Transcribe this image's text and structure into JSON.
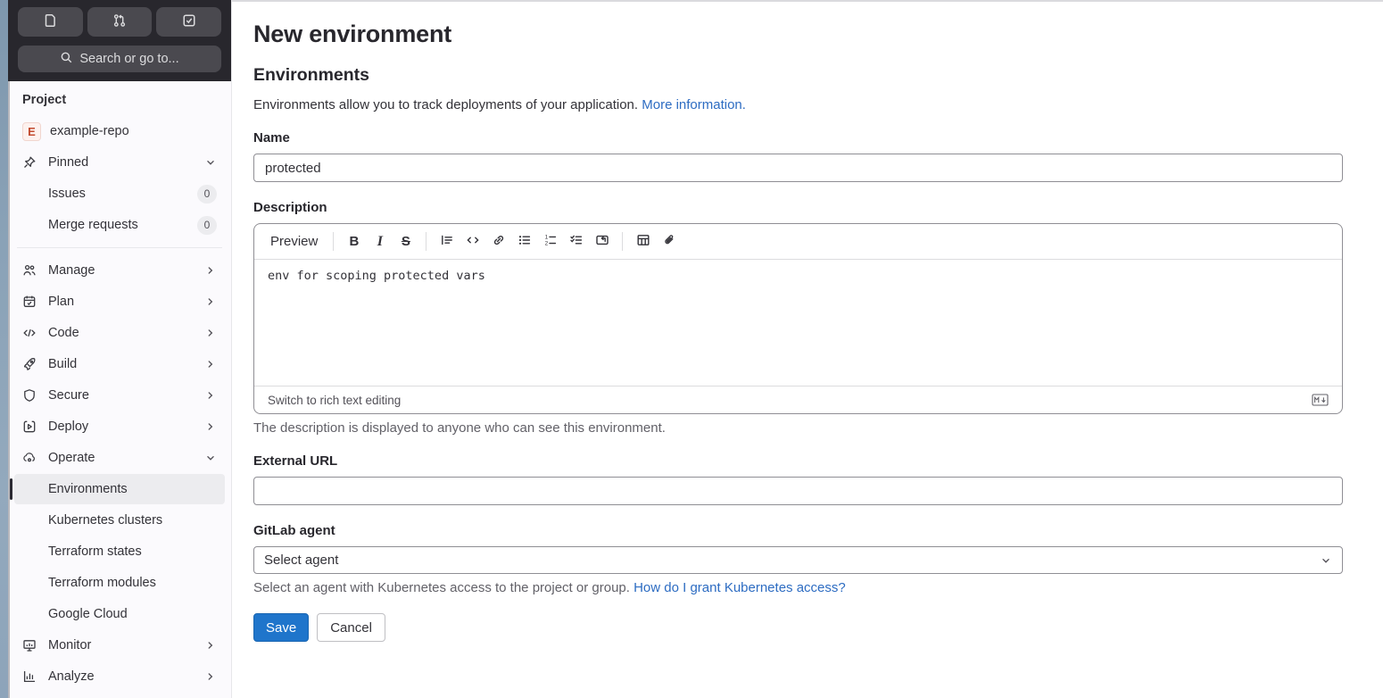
{
  "colors": {
    "sidebar_dark": "#28272d",
    "sidebar_button": "#4a494f",
    "active_item_bg": "#ececef",
    "accent_blue": "#1f75cb",
    "link_blue": "#2d6cc2",
    "avatar_red": "#c24a2e"
  },
  "sidebar": {
    "header_icons": [
      "issues-icon",
      "merge-request-icon",
      "todo-check-icon"
    ],
    "search_label": "Search or go to...",
    "section_label": "Project",
    "project": {
      "initial": "E",
      "name": "example-repo"
    },
    "items": {
      "pinned": "Pinned",
      "issues": "Issues",
      "issues_badge": "0",
      "merge_requests": "Merge requests",
      "merge_requests_badge": "0",
      "manage": "Manage",
      "plan": "Plan",
      "code": "Code",
      "build": "Build",
      "secure": "Secure",
      "deploy": "Deploy",
      "operate": "Operate",
      "environments": "Environments",
      "kubernetes_clusters": "Kubernetes clusters",
      "terraform_states": "Terraform states",
      "terraform_modules": "Terraform modules",
      "google_cloud": "Google Cloud",
      "monitor": "Monitor",
      "analyze": "Analyze"
    }
  },
  "main": {
    "title": "New environment",
    "heading": "Environments",
    "intro": {
      "text": "Environments allow you to track deployments of your application.",
      "link": "More information."
    },
    "name": {
      "label": "Name",
      "value": "protected"
    },
    "description": {
      "label": "Description",
      "toolbar": {
        "preview": "Preview",
        "bold": "B",
        "italic": "I",
        "strike": "S"
      },
      "toolbar_icons": [
        "quote-icon",
        "code-icon",
        "link-icon",
        "bullet-list-icon",
        "numbered-list-icon",
        "task-list-icon",
        "collapsible-section-icon",
        "table-icon",
        "attachment-icon"
      ],
      "value": "env for scoping protected vars",
      "switch_text": "Switch to rich text editing",
      "help": "The description is displayed to anyone who can see this environment."
    },
    "external_url": {
      "label": "External URL",
      "value": ""
    },
    "agent": {
      "label": "GitLab agent",
      "value": "Select agent",
      "help": "Select an agent with Kubernetes access to the project or group.",
      "help_link": "How do I grant Kubernetes access?"
    },
    "actions": {
      "save": "Save",
      "cancel": "Cancel"
    }
  }
}
